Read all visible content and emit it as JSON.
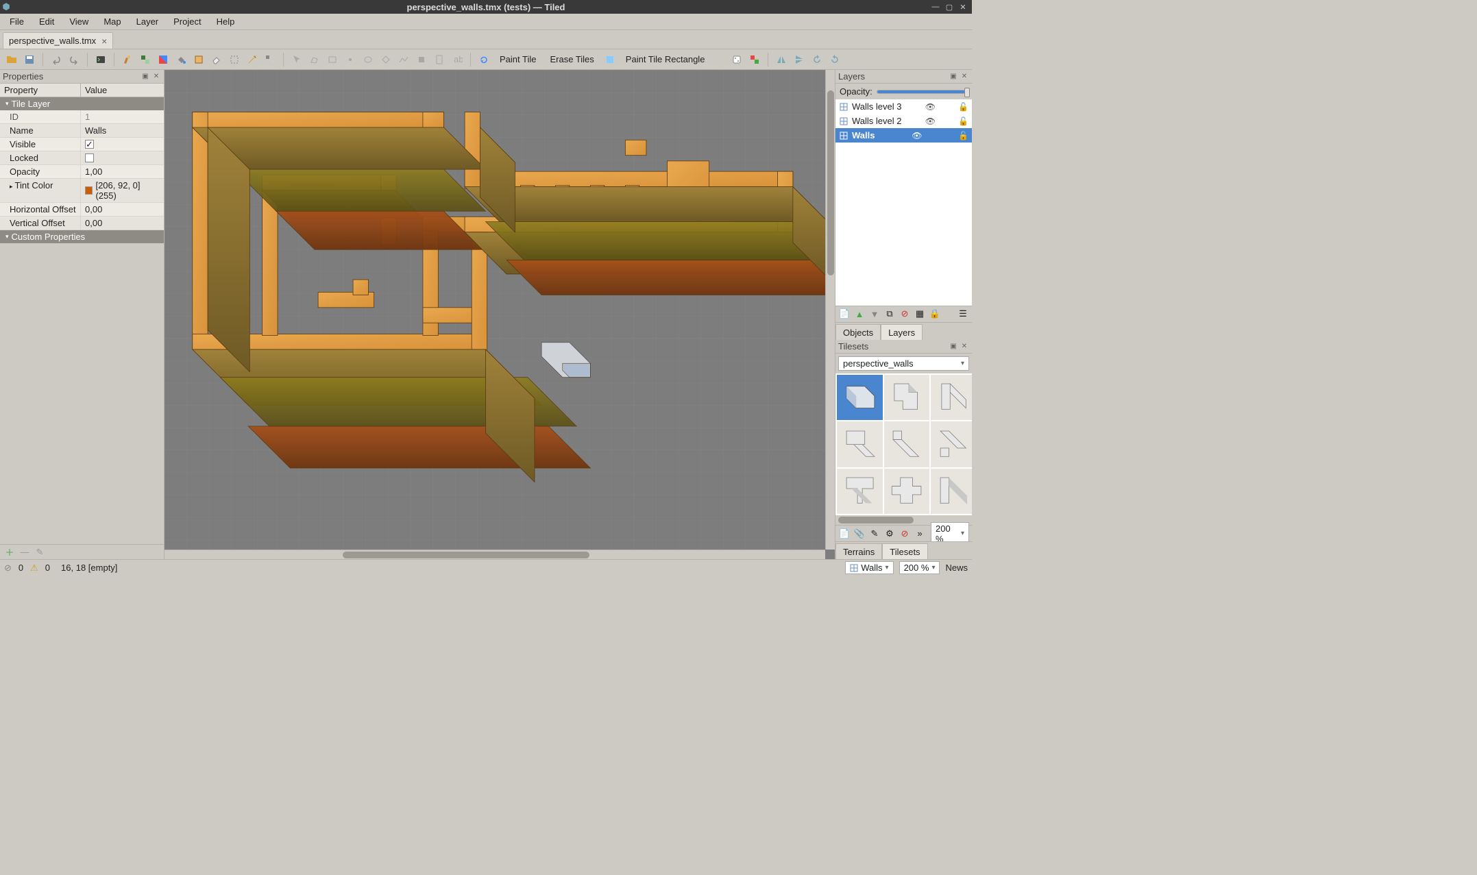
{
  "window": {
    "title": "perspective_walls.tmx (tests) — Tiled"
  },
  "menu": {
    "items": [
      "File",
      "Edit",
      "View",
      "Map",
      "Layer",
      "Project",
      "Help"
    ]
  },
  "doctab": {
    "label": "perspective_walls.tmx"
  },
  "toolbar": {
    "paint_tile": "Paint Tile",
    "erase_tiles": "Erase Tiles",
    "paint_rect": "Paint Tile Rectangle"
  },
  "properties": {
    "panel_title": "Properties",
    "col_property": "Property",
    "col_value": "Value",
    "group_tile_layer": "Tile Layer",
    "group_custom": "Custom Properties",
    "rows": {
      "id_label": "ID",
      "id_value": "1",
      "name_label": "Name",
      "name_value": "Walls",
      "visible_label": "Visible",
      "visible_value": "✓",
      "locked_label": "Locked",
      "locked_value": "",
      "opacity_label": "Opacity",
      "opacity_value": "1,00",
      "tint_label": "Tint Color",
      "tint_value": "[206, 92, 0] (255)",
      "tint_hex": "#ce5c00",
      "hoff_label": "Horizontal Offset",
      "hoff_value": "0,00",
      "voff_label": "Vertical Offset",
      "voff_value": "0,00"
    }
  },
  "layers": {
    "panel_title": "Layers",
    "opacity_label": "Opacity:",
    "items": [
      {
        "name": "Walls level 3",
        "selected": false
      },
      {
        "name": "Walls level 2",
        "selected": false
      },
      {
        "name": "Walls",
        "selected": true
      }
    ],
    "tabs": {
      "objects": "Objects",
      "layers": "Layers"
    }
  },
  "tilesets": {
    "panel_title": "Tilesets",
    "combo": "perspective_walls",
    "zoom_value": "200 %",
    "tabs": {
      "terrains": "Terrains",
      "tilesets": "Tilesets"
    }
  },
  "statusbar": {
    "errors": "0",
    "warnings": "0",
    "coords": "16, 18 [empty]",
    "layer_combo": "Walls",
    "zoom": "200 %",
    "news": "News"
  }
}
